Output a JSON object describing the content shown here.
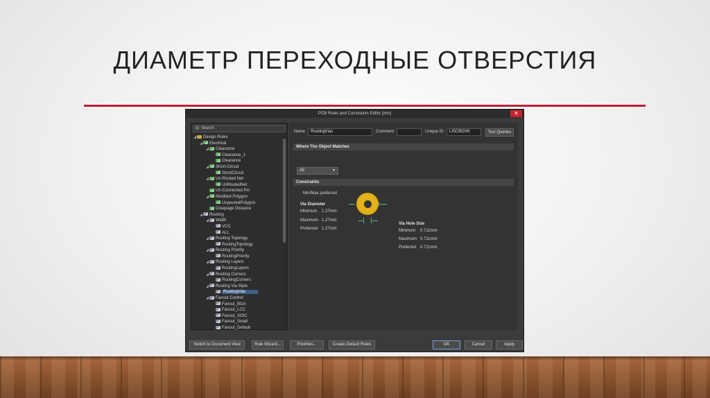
{
  "slide": {
    "title": "ДИАМЕТР ПЕРЕХОДНЫЕ ОТВЕРСТИЯ"
  },
  "dialog": {
    "title": "PCB Rules and Constraints Editor [mm]",
    "close_label": "✕"
  },
  "search": {
    "placeholder": "Search"
  },
  "tree": [
    {
      "label": "Design Rules",
      "level": 0,
      "arrow": "◢",
      "icon": "folder"
    },
    {
      "label": "Electrical",
      "level": 1,
      "arrow": "◢",
      "icon": "rule-el"
    },
    {
      "label": "Clearance",
      "level": 2,
      "arrow": "◢",
      "icon": "rule-el"
    },
    {
      "label": "Clearance_1",
      "level": 3,
      "arrow": "",
      "icon": "rule-el"
    },
    {
      "label": "Clearance",
      "level": 3,
      "arrow": "",
      "icon": "rule-el"
    },
    {
      "label": "Short-Circuit",
      "level": 2,
      "arrow": "◢",
      "icon": "rule-el"
    },
    {
      "label": "ShortCircuit",
      "level": 3,
      "arrow": "",
      "icon": "rule-el"
    },
    {
      "label": "Un-Routed Net",
      "level": 2,
      "arrow": "◢",
      "icon": "rule-el"
    },
    {
      "label": "UnRoutedNet",
      "level": 3,
      "arrow": "",
      "icon": "rule-el"
    },
    {
      "label": "Un-Connected Pin",
      "level": 2,
      "arrow": "",
      "icon": "rule-el"
    },
    {
      "label": "Modified Polygon",
      "level": 2,
      "arrow": "◢",
      "icon": "rule-el"
    },
    {
      "label": "UnpouredPolygon",
      "level": 3,
      "arrow": "",
      "icon": "rule-el"
    },
    {
      "label": "Creepage Distance",
      "level": 2,
      "arrow": "",
      "icon": "rule-el"
    },
    {
      "label": "Routing",
      "level": 1,
      "arrow": "◢",
      "icon": "rule-rt"
    },
    {
      "label": "Width",
      "level": 2,
      "arrow": "◢",
      "icon": "rule-rt"
    },
    {
      "label": "VCC",
      "level": 3,
      "arrow": "",
      "icon": "rule-rt"
    },
    {
      "label": "ALL",
      "level": 3,
      "arrow": "",
      "icon": "rule-rt"
    },
    {
      "label": "Routing Topology",
      "level": 2,
      "arrow": "◢",
      "icon": "rule-rt"
    },
    {
      "label": "RoutingTopology",
      "level": 3,
      "arrow": "",
      "icon": "rule-rt"
    },
    {
      "label": "Routing Priority",
      "level": 2,
      "arrow": "◢",
      "icon": "rule-rt"
    },
    {
      "label": "RoutingPriority",
      "level": 3,
      "arrow": "",
      "icon": "rule-rt"
    },
    {
      "label": "Routing Layers",
      "level": 2,
      "arrow": "◢",
      "icon": "rule-rt"
    },
    {
      "label": "RoutingLayers",
      "level": 3,
      "arrow": "",
      "icon": "rule-rt"
    },
    {
      "label": "Routing Corners",
      "level": 2,
      "arrow": "◢",
      "icon": "rule-rt"
    },
    {
      "label": "RoutingCorners",
      "level": 3,
      "arrow": "",
      "icon": "rule-rt"
    },
    {
      "label": "Routing Via Style",
      "level": 2,
      "arrow": "◢",
      "icon": "rule-rt"
    },
    {
      "label": "RoutingVias",
      "level": 3,
      "arrow": "",
      "icon": "rule-rt",
      "selected": true
    },
    {
      "label": "Fanout Control",
      "level": 2,
      "arrow": "◢",
      "icon": "rule-rt"
    },
    {
      "label": "Fanout_BGA",
      "level": 3,
      "arrow": "",
      "icon": "rule-rt"
    },
    {
      "label": "Fanout_LCC",
      "level": 3,
      "arrow": "",
      "icon": "rule-rt"
    },
    {
      "label": "Fanout_SOIC",
      "level": 3,
      "arrow": "",
      "icon": "rule-rt"
    },
    {
      "label": "Fanout_Small",
      "level": 3,
      "arrow": "",
      "icon": "rule-rt"
    },
    {
      "label": "Fanout_Default",
      "level": 3,
      "arrow": "",
      "icon": "rule-rt"
    }
  ],
  "rule": {
    "name_label": "Name",
    "name_value": "RoutingVias",
    "comment_label": "Comment",
    "comment_value": "",
    "uid_label": "Unique ID",
    "uid_value": "LISCBGVK",
    "test_queries_label": "Test Queries",
    "where_label": "Where The Object Matches",
    "match_value": "All",
    "constraints_label": "Constraints",
    "mode_label": "Min/Max preferred",
    "via_diameter": {
      "heading": "Via Diameter",
      "minimum_label": "Minimum",
      "minimum_value": "1.27mm",
      "maximum_label": "Maximum",
      "maximum_value": "1.27mm",
      "preferred_label": "Preferred",
      "preferred_value": "1.27mm"
    },
    "via_hole": {
      "heading": "Via Hole Size",
      "minimum_label": "Minimum",
      "minimum_value": "0.711mm",
      "maximum_label": "Maximum",
      "maximum_value": "0.711mm",
      "preferred_label": "Preferred",
      "preferred_value": "0.711mm"
    }
  },
  "buttons": {
    "switch_view": "Switch to Document View",
    "rule_wizard": "Rule Wizard...",
    "priorities": "Priorities...",
    "create_default": "Create Default Rules",
    "ok": "OK",
    "cancel": "Cancel",
    "apply": "Apply"
  },
  "colors": {
    "accent_rule": "#b8203a",
    "close": "#c8232b",
    "value_blue": "#6fa8e8",
    "via_pad": "#e3b21a",
    "selection": "#3f5f8c"
  }
}
